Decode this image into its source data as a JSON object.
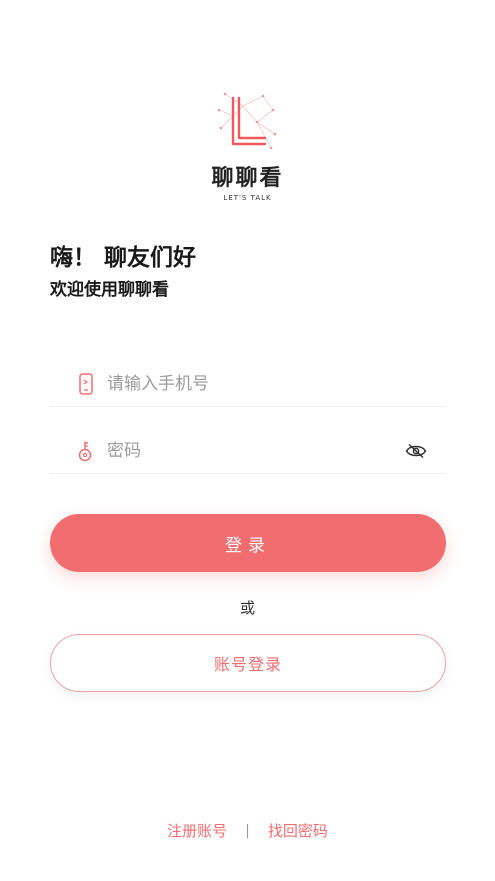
{
  "brand": {
    "name": "聊聊看",
    "tagline": "LET'S TALK",
    "accent_color": "#f26d70"
  },
  "greeting": {
    "title": "嗨！ 聊友们好",
    "subtitle": "欢迎使用聊聊看"
  },
  "form": {
    "phone_placeholder": "请输入手机号",
    "phone_icon": "phone-icon",
    "password_placeholder": "密码",
    "password_icon": "key-icon",
    "visibility_icon": "eye-hidden-icon"
  },
  "actions": {
    "login_label": "登录",
    "or_label": "或",
    "account_login_label": "账号登录"
  },
  "footer": {
    "register_label": "注册账号",
    "divider": "|",
    "forgot_label": "找回密码"
  }
}
